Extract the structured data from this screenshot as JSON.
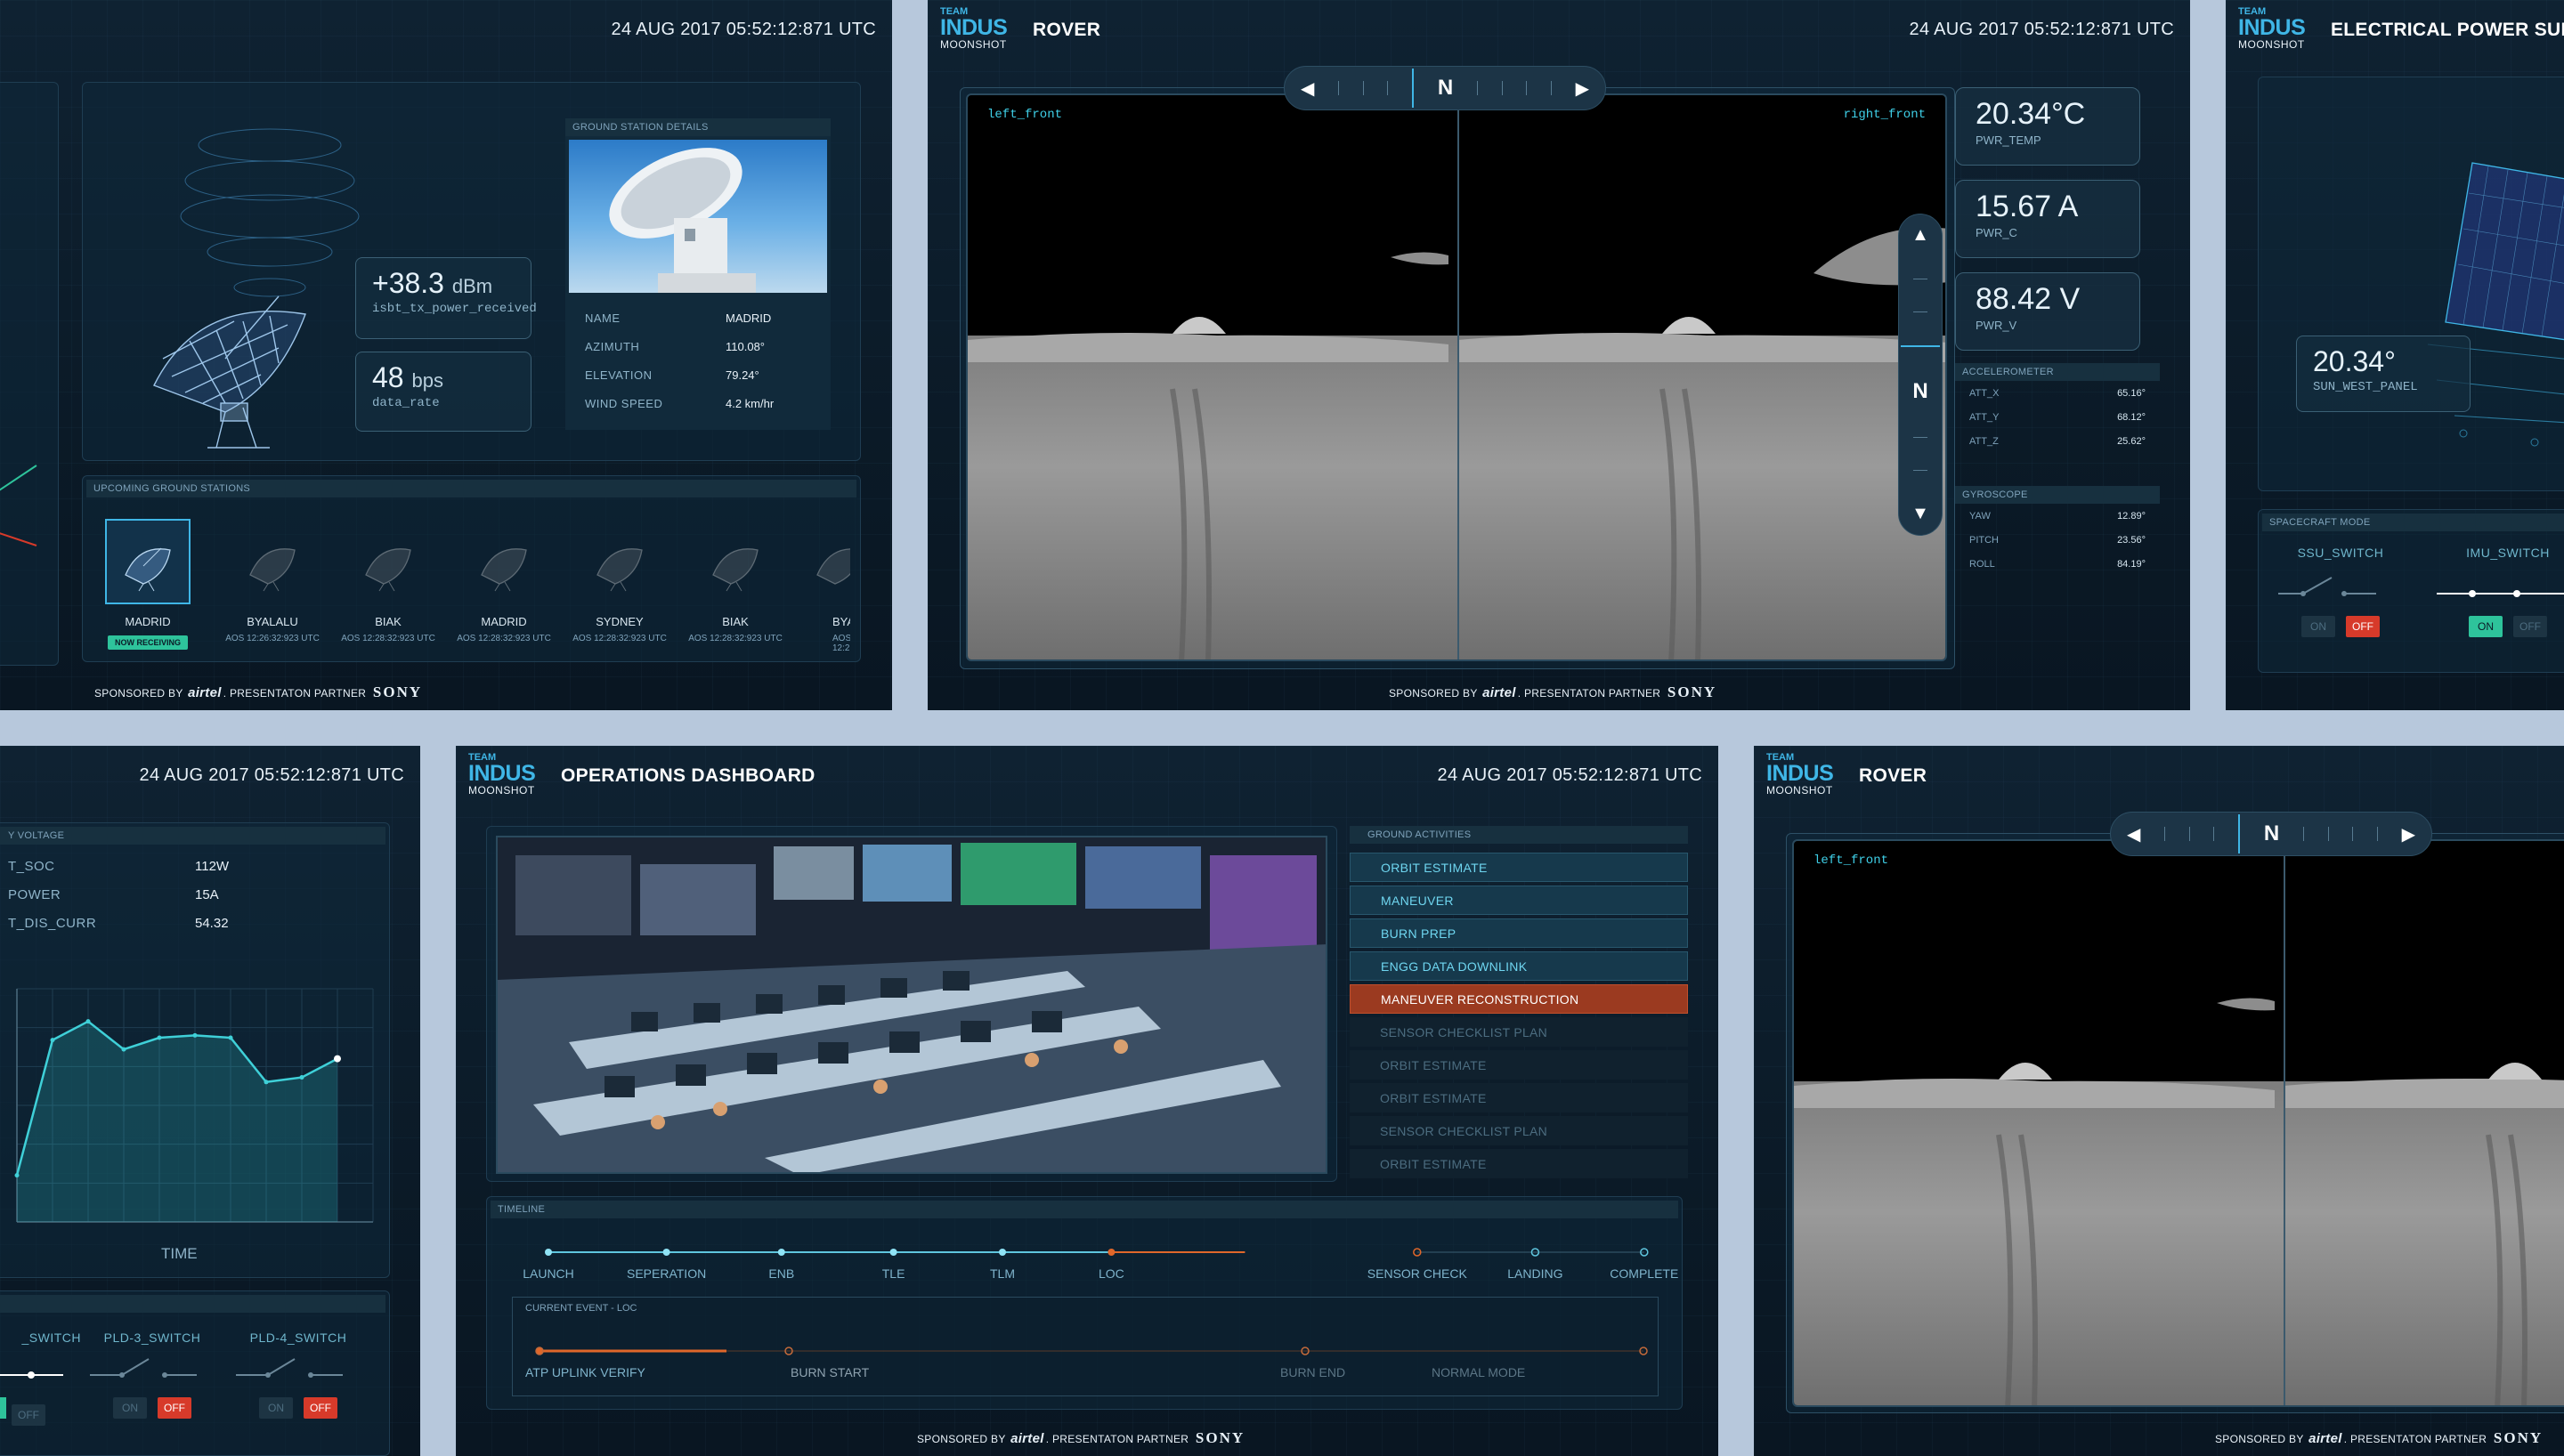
{
  "timestamp": "24 AUG 2017 05:52:12:871 UTC",
  "logo": {
    "line1": "TEAM",
    "line2": "INDUS",
    "line3": "MOONSHOT"
  },
  "sponsor": {
    "prefix": "SPONSORED BY",
    "brand1": "airtel",
    "partner": ". PRESENTATON PARTNER",
    "brand2": "SONY"
  },
  "ground": {
    "tx_power": {
      "value": "+38.3",
      "unit": "dBm",
      "key": "isbt_tx_power_received"
    },
    "data_rate": {
      "value": "48",
      "unit": "bps",
      "key": "data_rate"
    },
    "details_title": "GROUND STATION DETAILS",
    "details": [
      {
        "k": "NAME",
        "v": "MADRID"
      },
      {
        "k": "AZIMUTH",
        "v": "110.08°"
      },
      {
        "k": "ELEVATION",
        "v": "79.24°"
      },
      {
        "k": "WIND SPEED",
        "v": "4.2 km/hr"
      }
    ],
    "upcoming_title": "UPCOMING GROUND STATIONS",
    "stations": [
      {
        "name": "MADRID",
        "sub": "NOW RECEIVING"
      },
      {
        "name": "BYALALU",
        "sub": "AOS 12:26:32:923 UTC"
      },
      {
        "name": "BIAK",
        "sub": "AOS 12:28:32:923 UTC"
      },
      {
        "name": "MADRID",
        "sub": "AOS 12:28:32:923 UTC"
      },
      {
        "name": "SYDNEY",
        "sub": "AOS 12:28:32:923 UTC"
      },
      {
        "name": "BIAK",
        "sub": "AOS 12:28:32:923 UTC"
      },
      {
        "name": "BYA",
        "sub": "AOS 12:2"
      }
    ]
  },
  "rover": {
    "title": "ROVER",
    "compass_label": "N",
    "cam_left": "left_front",
    "cam_right": "right_front",
    "stats": [
      {
        "v": "20.34°C",
        "k": "PWR_TEMP"
      },
      {
        "v": "15.67 A",
        "k": "PWR_C"
      },
      {
        "v": "88.42 V",
        "k": "PWR_V"
      }
    ],
    "accel_title": "ACCELEROMETER",
    "accel": [
      {
        "k": "ATT_X",
        "v": "65.16°"
      },
      {
        "k": "ATT_Y",
        "v": "68.12°"
      },
      {
        "k": "ATT_Z",
        "v": "25.62°"
      }
    ],
    "gyro_title": "GYROSCOPE",
    "gyro": [
      {
        "k": "YAW",
        "v": "12.89°"
      },
      {
        "k": "PITCH",
        "v": "23.56°"
      },
      {
        "k": "ROLL",
        "v": "84.19°"
      }
    ]
  },
  "eps": {
    "title": "ELECTRICAL POWER SUBSY",
    "temp": {
      "v": "20.34°",
      "k": "SUN_WEST_PANEL"
    },
    "mode_title": "SPACECRAFT MODE",
    "switches": [
      {
        "name": "SSU_SWITCH",
        "on": "ON",
        "off": "OFF",
        "state": "off"
      },
      {
        "name": "IMU_SWITCH",
        "on": "ON",
        "off": "OFF",
        "state": "on"
      }
    ]
  },
  "payload": {
    "section_title": "Y VOLTAGE",
    "rows": [
      {
        "k": "T_SOC",
        "v": "112W"
      },
      {
        "k": "POWER",
        "v": "15A"
      },
      {
        "k": "T_DIS_CURR",
        "v": "54.32"
      }
    ],
    "xlabel": "TIME",
    "switches": [
      {
        "name": "_SWITCH",
        "on": "ON",
        "off": "OFF",
        "state": "on"
      },
      {
        "name": "PLD-3_SWITCH",
        "on": "ON",
        "off": "OFF",
        "state": "off"
      },
      {
        "name": "PLD-4_SWITCH",
        "on": "ON",
        "off": "OFF",
        "state": "off"
      }
    ]
  },
  "chart_data": {
    "type": "line",
    "x": [
      0,
      1,
      2,
      3,
      4,
      5,
      6,
      7,
      8,
      9
    ],
    "values": [
      0.2,
      0.78,
      0.86,
      0.74,
      0.79,
      0.8,
      0.79,
      0.6,
      0.62,
      0.7
    ],
    "xlabel": "TIME",
    "ylabel": "",
    "ylim": [
      0,
      1
    ],
    "grid": true
  },
  "ops": {
    "title": "OPERATIONS DASHBOARD",
    "activities_title": "GROUND ACTIVITIES",
    "activities": [
      {
        "label": "ORBIT ESTIMATE",
        "state": "done"
      },
      {
        "label": "MANEUVER",
        "state": "done"
      },
      {
        "label": "BURN PREP",
        "state": "done"
      },
      {
        "label": "ENGG DATA DOWNLINK",
        "state": "done"
      },
      {
        "label": "MANEUVER RECONSTRUCTION",
        "state": "cur"
      },
      {
        "label": "SENSOR CHECKLIST PLAN",
        "state": "pend"
      },
      {
        "label": "ORBIT ESTIMATE",
        "state": "pend"
      },
      {
        "label": "ORBIT ESTIMATE",
        "state": "pend"
      },
      {
        "label": "SENSOR CHECKLIST PLAN",
        "state": "pend"
      },
      {
        "label": "ORBIT ESTIMATE",
        "state": "pend"
      }
    ],
    "timeline_title": "TIMELINE",
    "timeline": [
      "LAUNCH",
      "SEPERATION",
      "ENB",
      "TLE",
      "TLM",
      "LOC",
      "SENSOR CHECK",
      "LANDING",
      "COMPLETE"
    ],
    "timeline_current": 5,
    "current_event_title": "CURRENT EVENT - LOC",
    "events": [
      "ATP UPLINK VERIFY",
      "BURN START",
      "BURN END",
      "NORMAL MODE"
    ]
  },
  "colors": {
    "accent": "#3fb6e6",
    "teal": "#2ec39b",
    "orange": "#e0672a",
    "red": "#d73a2a"
  }
}
